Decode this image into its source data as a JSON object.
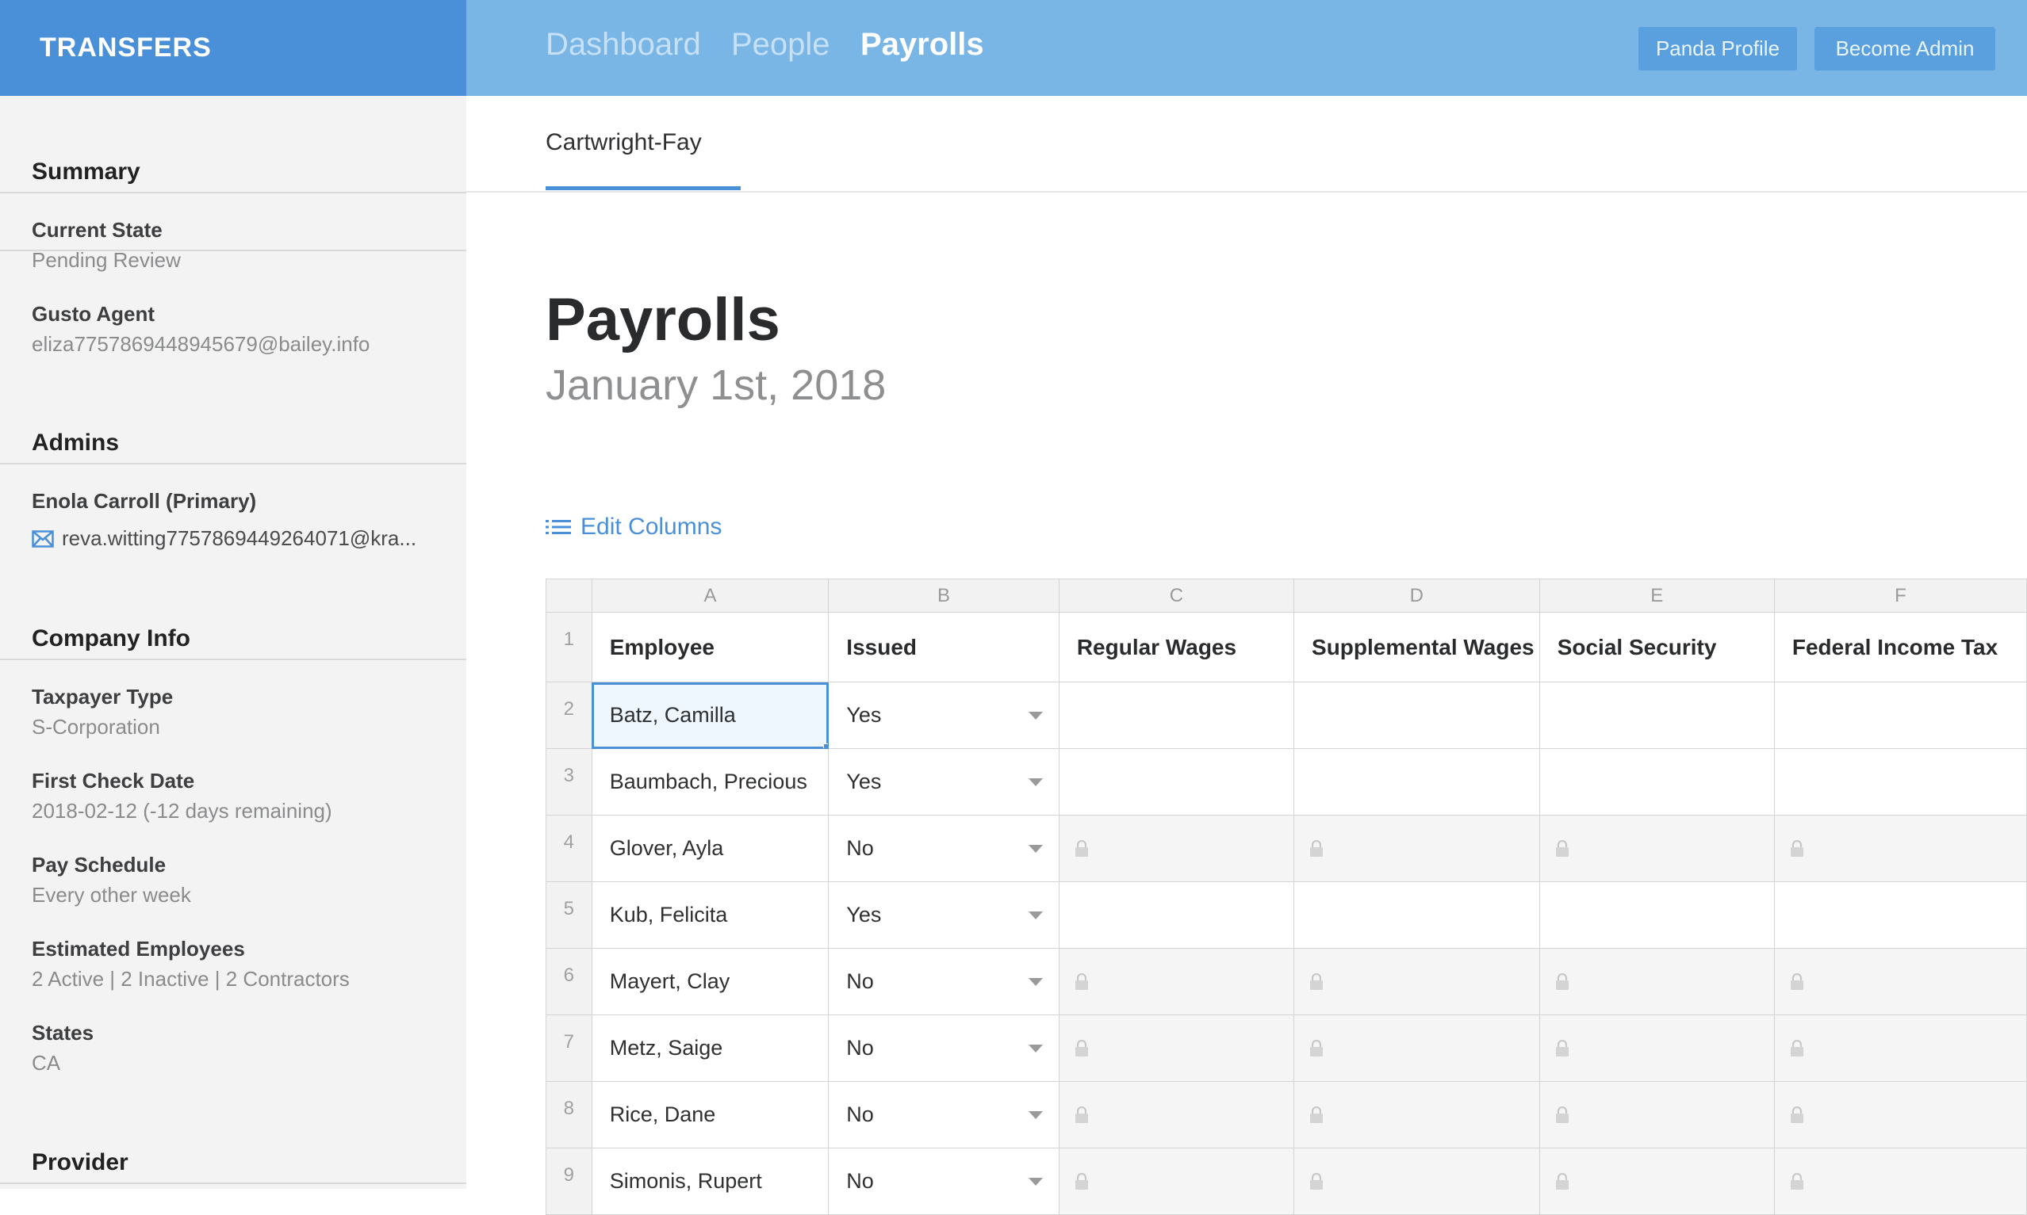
{
  "brand": "TRANSFERS",
  "nav": [
    "Dashboard",
    "People",
    "Payrolls"
  ],
  "buttons": {
    "panda_profile": "Panda Profile",
    "become_admin": "Become Admin"
  },
  "sidebar": {
    "summary_heading": "Summary",
    "current_state_label": "Current State",
    "current_state_value": "Pending Review",
    "agent_label": "Gusto Agent",
    "agent_value": "eliza7757869448945679@bailey.info",
    "admins_heading": "Admins",
    "admin_name": "Enola Carroll (Primary)",
    "admin_email": "reva.witting7757869449264071@kra...",
    "company_heading": "Company Info",
    "taxpayer_label": "Taxpayer Type",
    "taxpayer_value": "S-Corporation",
    "first_check_label": "First Check Date",
    "first_check_value": "2018-02-12 (-12 days remaining)",
    "pay_schedule_label": "Pay Schedule",
    "pay_schedule_value": "Every other week",
    "est_employees_label": "Estimated Employees",
    "est_employees_value": "2 Active | 2 Inactive | 2 Contractors",
    "states_label": "States",
    "states_value": "CA",
    "provider_heading": "Provider"
  },
  "tab": "Cartwright-Fay",
  "page_title": "Payrolls",
  "page_subtitle": "January 1st, 2018",
  "edit_columns": "Edit Columns",
  "grid": {
    "col_letters": [
      "A",
      "B",
      "C",
      "D",
      "E",
      "F"
    ],
    "headers": [
      "Employee",
      "Issued",
      "Regular Wages",
      "Supplemental Wages",
      "Social Security",
      "Federal Income Tax"
    ],
    "row_numbers": [
      "1",
      "2",
      "3",
      "4",
      "5",
      "6",
      "7",
      "8",
      "9"
    ],
    "rows": [
      {
        "employee": "Batz, Camilla",
        "issued": "Yes"
      },
      {
        "employee": "Baumbach, Precious",
        "issued": "Yes"
      },
      {
        "employee": "Glover, Ayla",
        "issued": "No"
      },
      {
        "employee": "Kub, Felicita",
        "issued": "Yes"
      },
      {
        "employee": "Mayert, Clay",
        "issued": "No"
      },
      {
        "employee": "Metz, Saige",
        "issued": "No"
      },
      {
        "employee": "Rice, Dane",
        "issued": "No"
      },
      {
        "employee": "Simonis, Rupert",
        "issued": "No"
      }
    ]
  },
  "colors": {
    "brand_blue": "#4a90d9",
    "topbar_blue": "#7ab6e5"
  },
  "icons": {
    "mail": "envelope-icon",
    "edit_columns": "list-icon",
    "lock": "lock-icon",
    "caret": "caret-down-icon"
  }
}
